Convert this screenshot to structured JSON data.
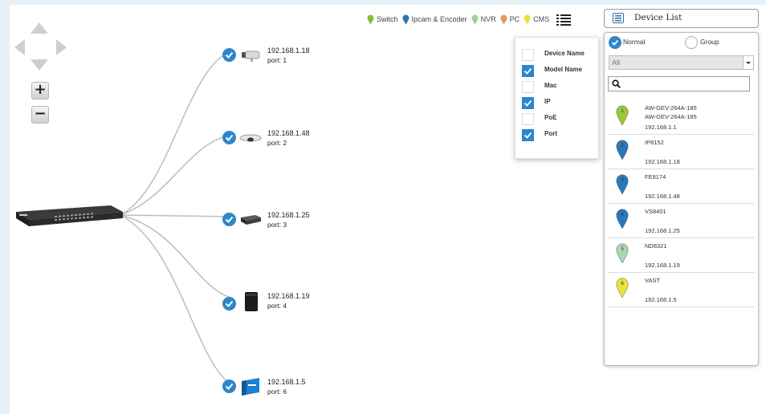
{
  "legend": {
    "items": [
      {
        "label": "Switch",
        "color": "#8bbd3c"
      },
      {
        "label": "Ipcam & Encoder",
        "color": "#2b78b8"
      },
      {
        "label": "NVR",
        "color": "#9ccf9e"
      },
      {
        "label": "PC",
        "color": "#e8955a"
      },
      {
        "label": "CMS",
        "color": "#e7e23a"
      }
    ]
  },
  "topology": {
    "nodes": [
      {
        "ip": "192.168.1.18",
        "port": "port: 1"
      },
      {
        "ip": "192.168.1.48",
        "port": "port: 2"
      },
      {
        "ip": "192.168.1.25",
        "port": "port: 3"
      },
      {
        "ip": "192.168.1.19",
        "port": "port: 4"
      },
      {
        "ip": "192.168.1.5",
        "port": "port: 6"
      }
    ],
    "zoom_in": "+",
    "zoom_out": "−",
    "link_color": "#bdbdbd"
  },
  "columns": [
    {
      "label": "Device Name",
      "checked": false
    },
    {
      "label": "Model Name",
      "checked": true
    },
    {
      "label": "Mac",
      "checked": false
    },
    {
      "label": "IP",
      "checked": true
    },
    {
      "label": "PoE",
      "checked": false
    },
    {
      "label": "Port",
      "checked": true
    }
  ],
  "device_list": {
    "title": "Device List",
    "view_normal": "Normal",
    "view_group": "Group",
    "filter_value": "All",
    "devices": [
      {
        "num": "1",
        "color": "#9cc93a",
        "l1": "AW-GEV-264A-185",
        "l2": "AW-GEV-264A-185",
        "l3": "192.168.1.1"
      },
      {
        "num": "2",
        "color": "#2b78b8",
        "l1": "IP8152",
        "l2": "",
        "l3": "192.168.1.18"
      },
      {
        "num": "3",
        "color": "#2b78b8",
        "l1": "FE8174",
        "l2": "",
        "l3": "192.168.1.48"
      },
      {
        "num": "4",
        "color": "#2b78b8",
        "l1": "VS8401",
        "l2": "",
        "l3": "192.168.1.25"
      },
      {
        "num": "5",
        "color": "#a8d8b0",
        "l1": "ND8321",
        "l2": "",
        "l3": "192.168.1.19"
      },
      {
        "num": "6",
        "color": "#eae43c",
        "l1": "VAST",
        "l2": "",
        "l3": "192.168.1.5"
      }
    ]
  }
}
